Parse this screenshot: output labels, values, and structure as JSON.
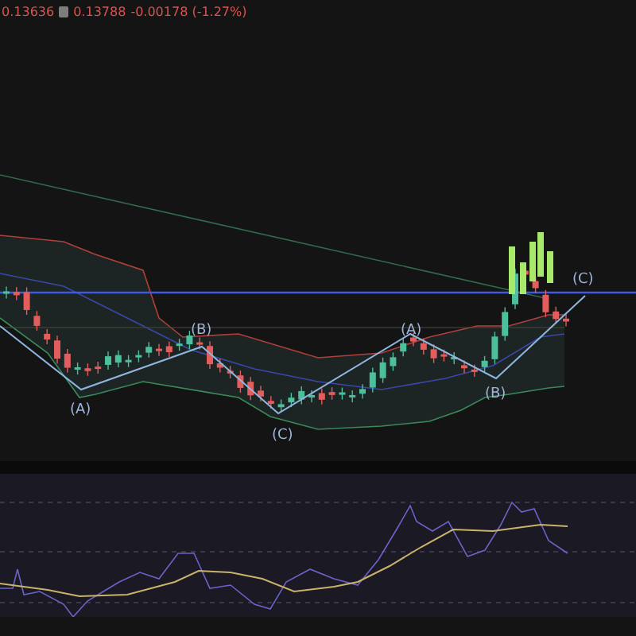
{
  "header": {
    "price_1": "0.13636",
    "price_2": "0.13788",
    "change": "-0.00178 (-1.27%)"
  },
  "chart": {
    "wave_labels": [
      {
        "text": "(A)"
      },
      {
        "text": "(B)"
      },
      {
        "text": "(C)"
      },
      {
        "text": "(A)"
      },
      {
        "text": "(B)"
      },
      {
        "text": "(C)"
      }
    ]
  }
}
